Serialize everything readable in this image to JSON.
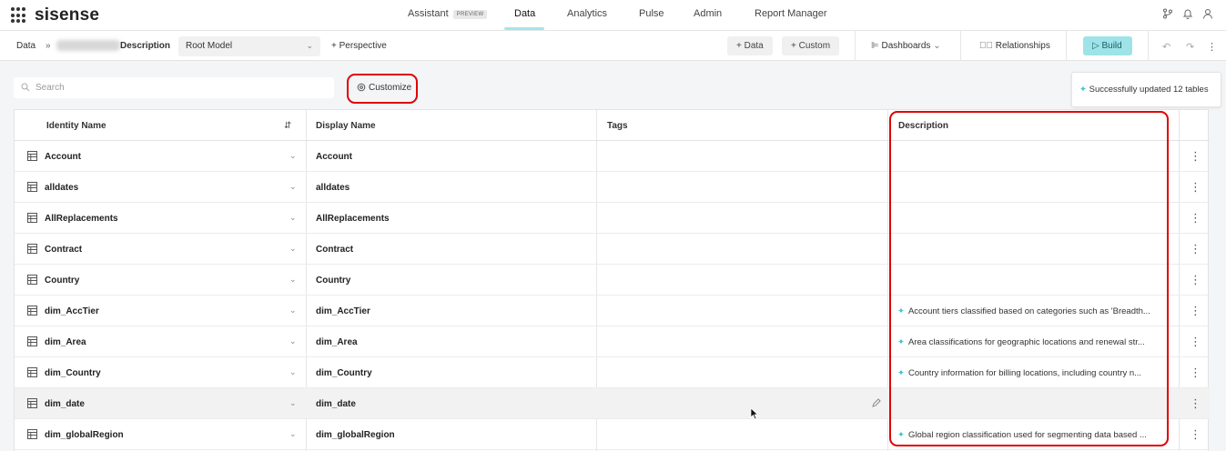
{
  "app": {
    "name": "sisense"
  },
  "nav": {
    "tabs": [
      {
        "label": "Assistant",
        "badge": "PREVIEW"
      },
      {
        "label": "Data"
      },
      {
        "label": "Analytics"
      },
      {
        "label": "Pulse"
      },
      {
        "label": "Admin"
      },
      {
        "label": "Report Manager"
      }
    ],
    "active_tab": "Data"
  },
  "toolbar": {
    "crumb_root": "Data",
    "crumb_sep": "»",
    "crumb_current": "Description",
    "model_select": "Root Model",
    "perspective_label": "+ Perspective",
    "add_data_label": "+ Data",
    "add_custom_label": "+ Custom",
    "dashboards_label": "Dashboards",
    "relationships_label": "Relationships",
    "build_label": "▷ Build"
  },
  "search": {
    "placeholder": "Search"
  },
  "customize": {
    "label": "Customize"
  },
  "toast": {
    "message": "Successfully updated 12 tables"
  },
  "table": {
    "columns": {
      "identity": "Identity Name",
      "display": "Display Name",
      "tags": "Tags",
      "description": "Description"
    },
    "rows": [
      {
        "identity": "Account",
        "display": "Account",
        "description": ""
      },
      {
        "identity": "alldates",
        "display": "alldates",
        "description": ""
      },
      {
        "identity": "AllReplacements",
        "display": "AllReplacements",
        "description": ""
      },
      {
        "identity": "Contract",
        "display": "Contract",
        "description": ""
      },
      {
        "identity": "Country",
        "display": "Country",
        "description": ""
      },
      {
        "identity": "dim_AccTier",
        "display": "dim_AccTier",
        "description": "Account tiers classified based on categories such as 'Breadth..."
      },
      {
        "identity": "dim_Area",
        "display": "dim_Area",
        "description": "Area classifications for geographic locations and renewal str..."
      },
      {
        "identity": "dim_Country",
        "display": "dim_Country",
        "description": "Country information for billing locations, including country n..."
      },
      {
        "identity": "dim_date",
        "display": "dim_date",
        "description": ""
      },
      {
        "identity": "dim_globalRegion",
        "display": "dim_globalRegion",
        "description": "Global region classification used for segmenting data based ..."
      }
    ]
  },
  "colors": {
    "accent": "#a4e5ea",
    "build": "#9ee3e8",
    "highlight": "#e00000",
    "sparkle": "#40c4d0"
  }
}
